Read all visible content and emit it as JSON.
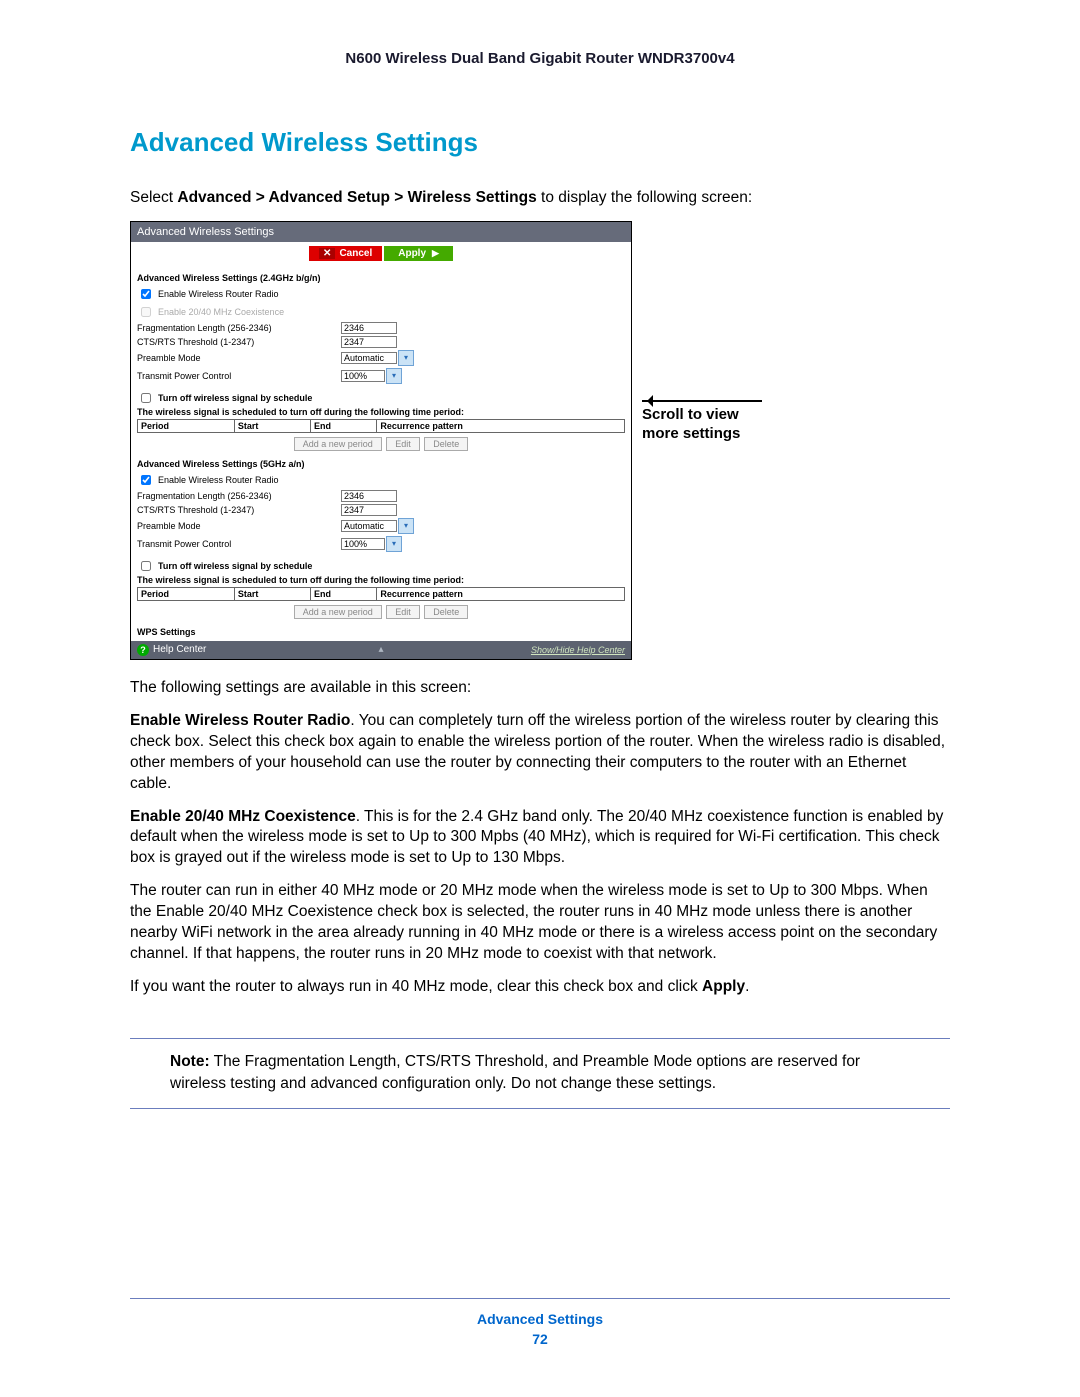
{
  "header": "N600 Wireless Dual Band Gigabit Router WNDR3700v4",
  "h1": "Advanced Wireless Settings",
  "intro_pre": "Select ",
  "intro_bold": "Advanced > Advanced Setup > Wireless Settings",
  "intro_post": " to display the following screen:",
  "callout_l1": "Scroll to view",
  "callout_l2": "more settings",
  "shot": {
    "title": "Advanced Wireless Settings",
    "cancel": "Cancel",
    "apply": "Apply",
    "sect24": "Advanced Wireless Settings (2.4GHz b/g/n)",
    "sect5": "Advanced Wireless Settings (5GHz a/n)",
    "enable_radio": "Enable Wireless Router Radio",
    "enable_coex": "Enable 20/40 MHz Coexistence",
    "frag": "Fragmentation Length (256-2346)",
    "frag_val": "2346",
    "cts": "CTS/RTS Threshold (1-2347)",
    "cts_val": "2347",
    "preamble": "Preamble Mode",
    "preamble_val": "Automatic",
    "txpower": "Transmit Power Control",
    "txpower_val": "100%",
    "turnoff": "Turn off wireless signal by schedule",
    "schedline": "The wireless signal is scheduled to turn off during the following time period:",
    "th_period": "Period",
    "th_start": "Start",
    "th_end": "End",
    "th_rec": "Recurrence pattern",
    "btn_add": "Add a new period",
    "btn_edit": "Edit",
    "btn_del": "Delete",
    "wps": "WPS Settings",
    "help": "Help Center",
    "showhide": "Show/Hide Help Center"
  },
  "p1": "The following settings are available in this screen:",
  "p2_b": "Enable Wireless Router Radio",
  "p2": ". You can completely turn off the wireless portion of the wireless router by clearing this check box. Select this check box again to enable the wireless portion of the router. When the wireless radio is disabled, other members of your household can use the router by connecting their computers to the router with an Ethernet cable.",
  "p3_b": "Enable 20/40 MHz Coexistence",
  "p3": ". This is for the 2.4 GHz band only. The 20/40 MHz coexistence function is enabled by default when the wireless mode is set to Up to 300 Mpbs (40 MHz), which is required for Wi-Fi certification. This check box is grayed out if the wireless mode is set to Up to 130 Mbps.",
  "p4": "The router can run in either 40 MHz mode or 20 MHz mode when the wireless mode is set to Up to 300 Mbps. When the Enable 20/40 MHz Coexistence check box is selected, the router runs in 40 MHz mode unless there is another nearby WiFi network in the area already running in 40 MHz mode or there is a wireless access point on the secondary channel. If that happens, the router runs in 20 MHz mode to coexist with that network.",
  "p5_pre": "If you want the router to always run in 40 MHz mode, clear this check box and click ",
  "p5_b": "Apply",
  "p5_post": ".",
  "note_b": "Note:",
  "note": " The Fragmentation Length, CTS/RTS Threshold, and Preamble Mode options are reserved for wireless testing and advanced configuration only. Do not change these settings.",
  "footer_sec": "Advanced Settings",
  "footer_pg": "72"
}
